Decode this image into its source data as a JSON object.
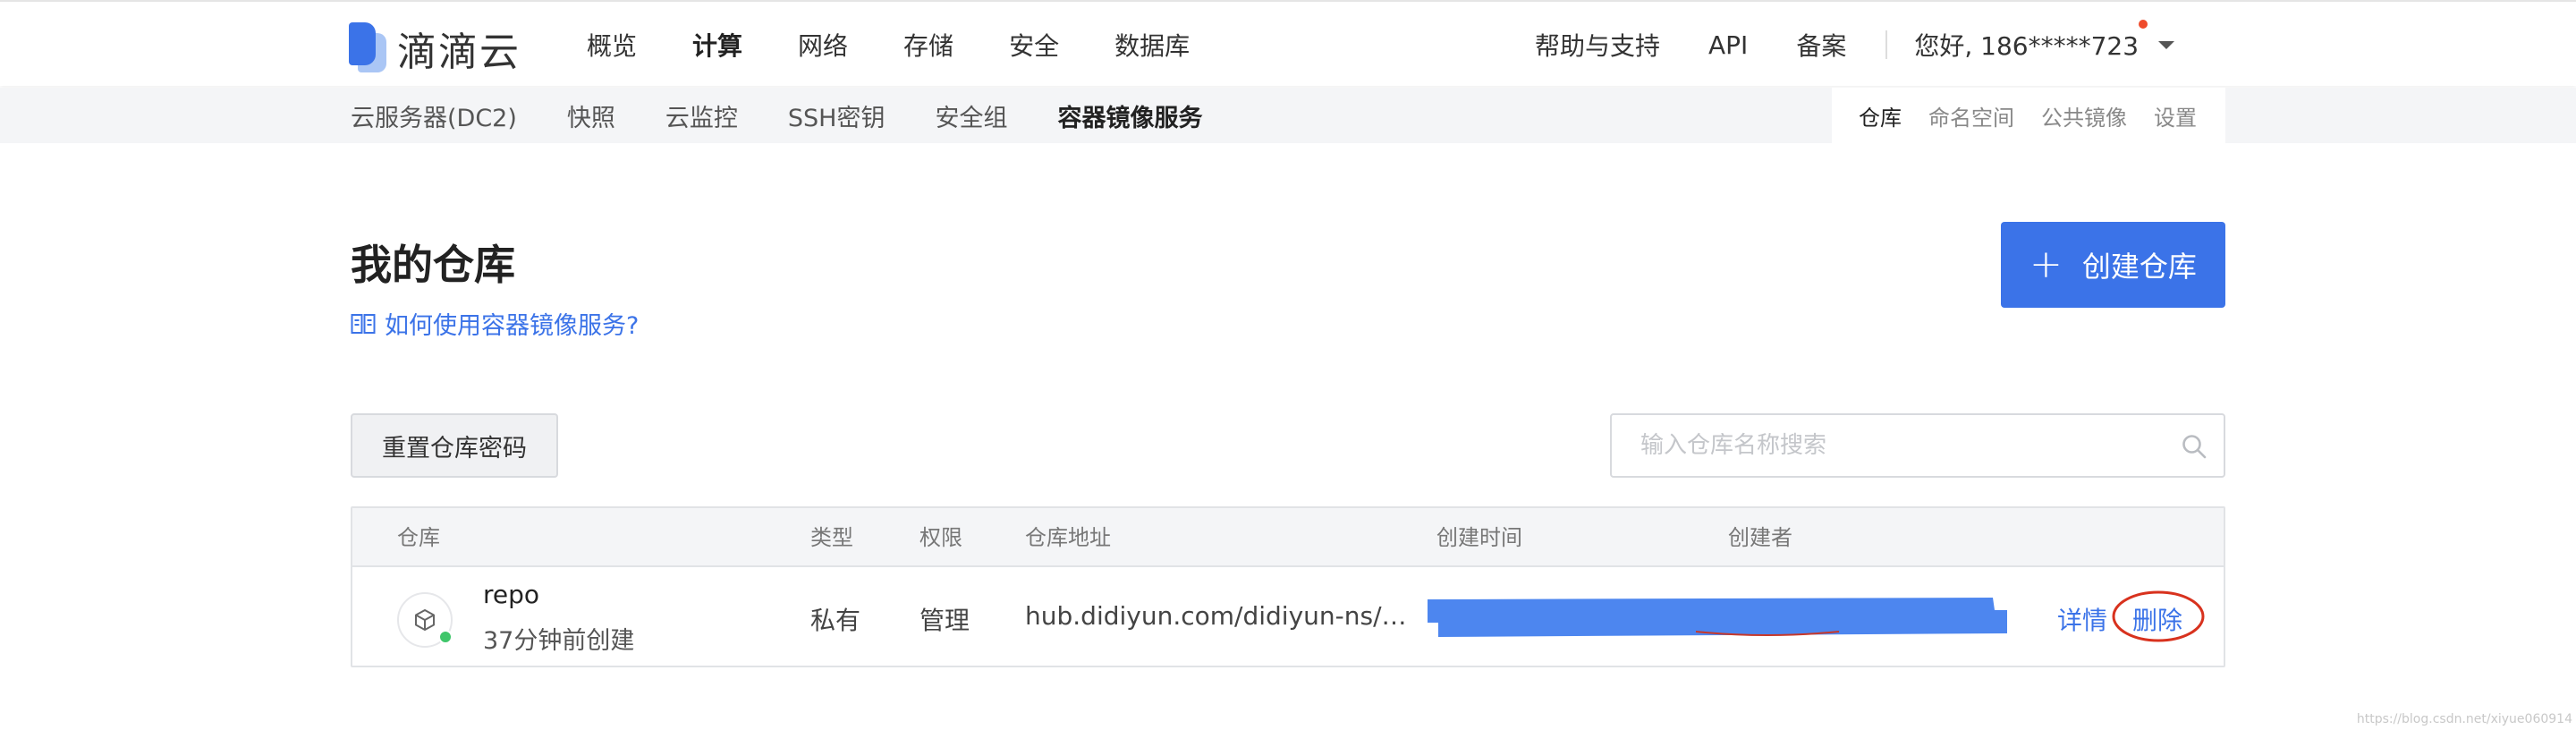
{
  "brand": {
    "name": "滴滴云"
  },
  "main_nav": [
    "概览",
    "计算",
    "网络",
    "存储",
    "安全",
    "数据库"
  ],
  "main_nav_active": 1,
  "right_nav": {
    "help": "帮助与支持",
    "api": "API",
    "beian": "备案",
    "user": "您好, 186*****723"
  },
  "sub_nav": [
    "云服务器(DC2)",
    "快照",
    "云监控",
    "SSH密钥",
    "安全组",
    "容器镜像服务"
  ],
  "sub_nav_right": [
    "仓库",
    "命名空间",
    "公共镜像",
    "设置"
  ],
  "page": {
    "title": "我的仓库",
    "help_link": "如何使用容器镜像服务?",
    "create_button": "创建仓库"
  },
  "toolbar": {
    "reset_button": "重置仓库密码",
    "search_placeholder": "输入仓库名称搜索"
  },
  "table": {
    "headers": {
      "repo": "仓库",
      "type": "类型",
      "permission": "权限",
      "address": "仓库地址",
      "created_time": "创建时间",
      "creator": "创建者"
    },
    "rows": [
      {
        "name": "repo",
        "created_ago": "37分钟前创建",
        "type": "私有",
        "permission": "管理",
        "address": "hub.didiyun.com/didiyun-ns/…",
        "actions": {
          "detail": "详情",
          "delete": "删除"
        }
      }
    ]
  },
  "watermark": "https://blog.csdn.net/xiyue060914",
  "colors": {
    "accent": "#3b73e8",
    "redaction": "#4d86ef",
    "annotation": "#d8321e",
    "status_ok": "#3fc66a"
  }
}
